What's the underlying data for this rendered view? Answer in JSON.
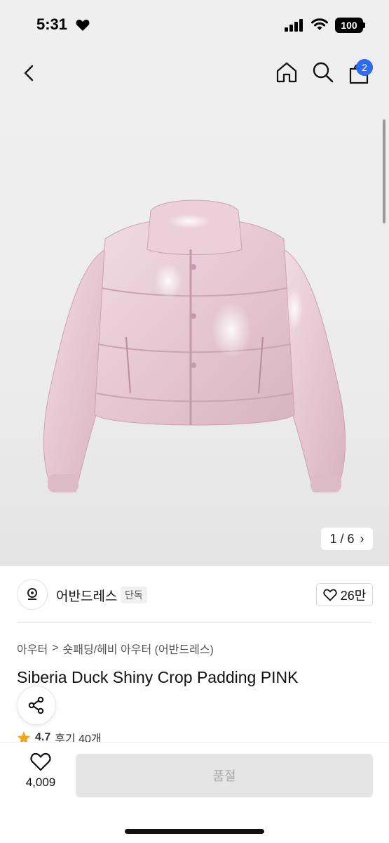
{
  "status_bar": {
    "time": "5:31",
    "battery": "100"
  },
  "nav": {
    "cart_badge": "2"
  },
  "gallery": {
    "counter": "1 / 6"
  },
  "brand": {
    "name": "어반드레스",
    "tag": "단독",
    "like_count": "26만"
  },
  "breadcrumb": {
    "level1": "아우터",
    "separator": ">",
    "level2": "숏패딩/헤비 아우터 (어반드레스)"
  },
  "product": {
    "title": "Siberia Duck Shiny Crop Padding PINK"
  },
  "rating": {
    "score": "4.7",
    "review_label": "후기 40개"
  },
  "bottom": {
    "wish_count": "4,009",
    "action_label": "품절"
  },
  "colors": {
    "accent": "#2f6bf0",
    "jacket": "#e9cdd6",
    "star": "#f2a516"
  }
}
